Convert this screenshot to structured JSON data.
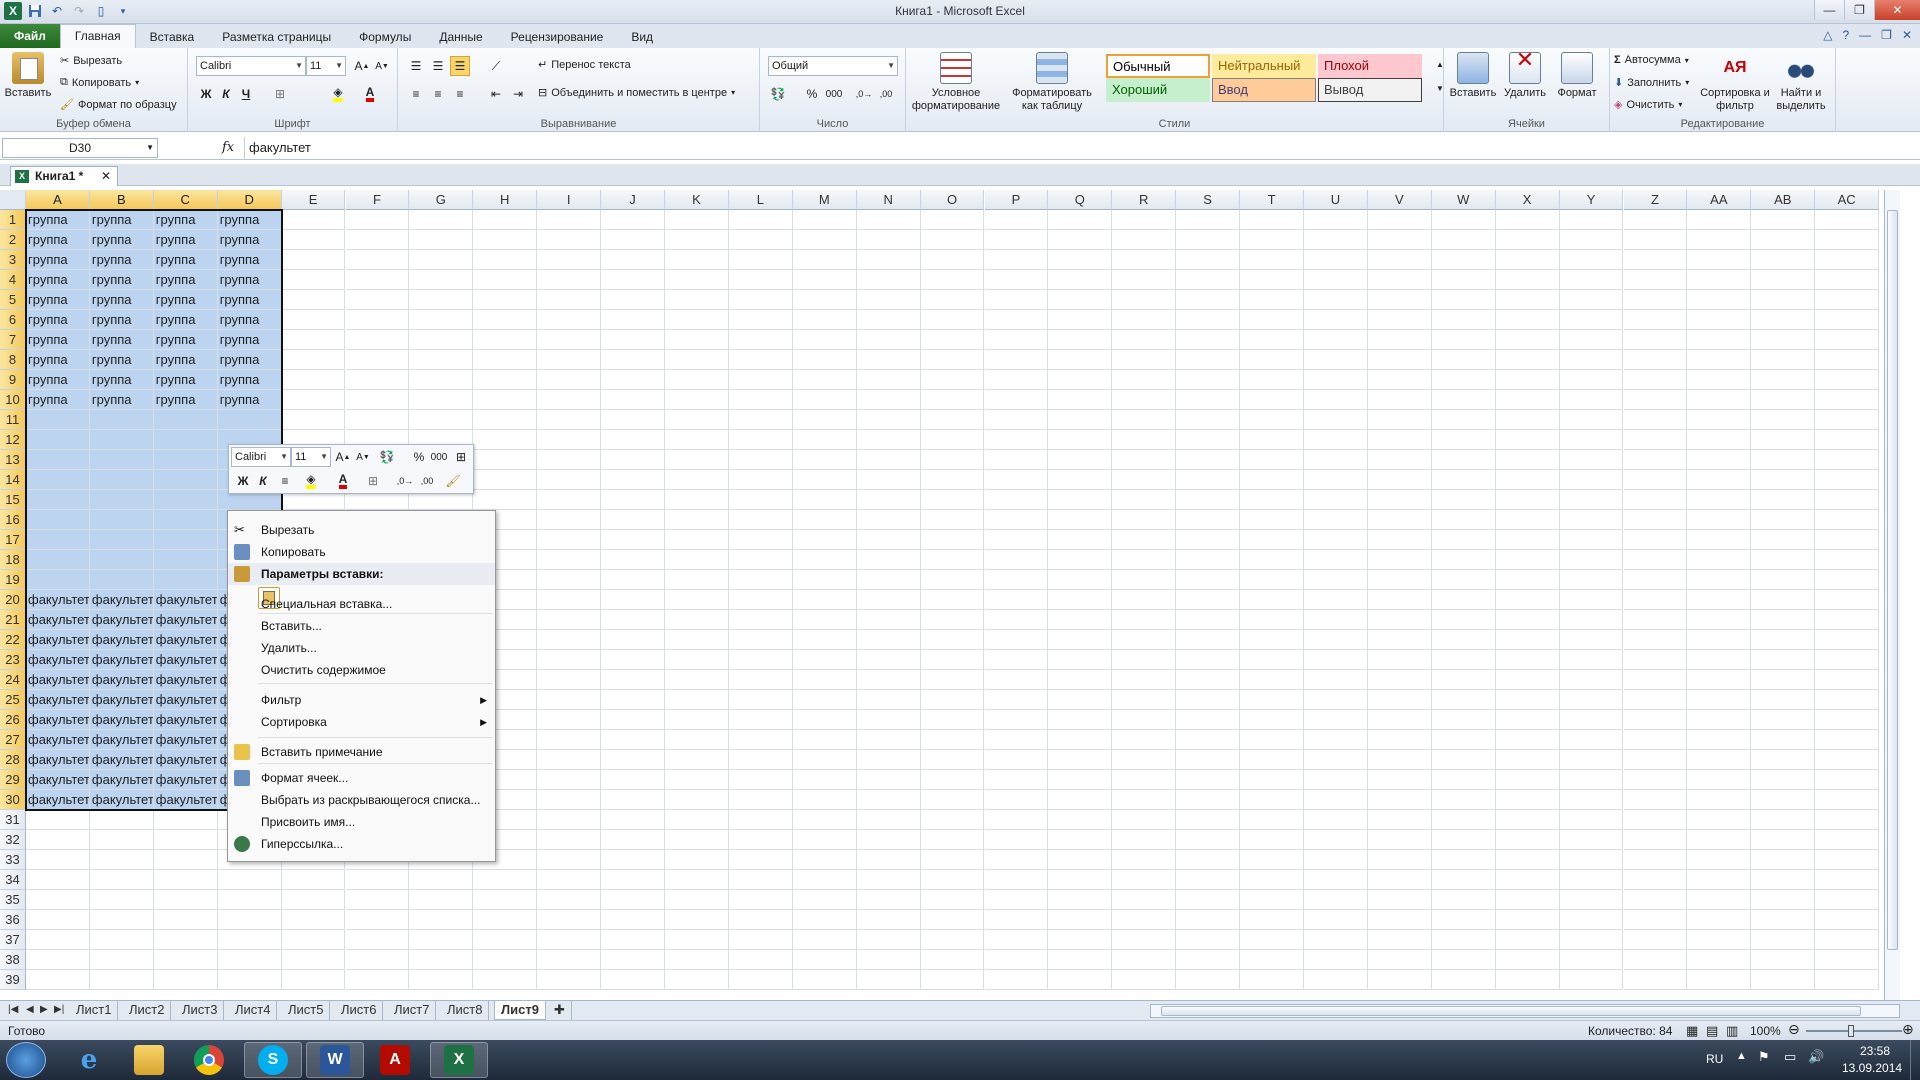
{
  "window": {
    "title": "Книга1 - Microsoft Excel"
  },
  "ribbon_tabs": [
    "Файл",
    "Главная",
    "Вставка",
    "Разметка страницы",
    "Формулы",
    "Данные",
    "Рецензирование",
    "Вид"
  ],
  "clipboard": {
    "paste": "Вставить",
    "cut": "Вырезать",
    "copy": "Копировать",
    "format_painter": "Формат по образцу",
    "label": "Буфер обмена"
  },
  "font": {
    "name": "Calibri",
    "size": "11",
    "bold": "Ж",
    "italic": "К",
    "underline": "Ч",
    "label": "Шрифт"
  },
  "alignment": {
    "wrap": "Перенос текста",
    "merge": "Объединить и поместить в центре",
    "label": "Выравнивание"
  },
  "number": {
    "format": "Общий",
    "percent": "%",
    "thousands": "000",
    "label": "Число"
  },
  "styles": {
    "cond_format": "Условное форматирование",
    "as_table": "Форматировать как таблицу",
    "cells": [
      {
        "name": "Обычный",
        "bg": "#ffffff",
        "fg": "#000000",
        "border": "#f0a030"
      },
      {
        "name": "Нейтральный",
        "bg": "#ffeb9c",
        "fg": "#9c6500",
        "border": "#ffeb9c"
      },
      {
        "name": "Плохой",
        "bg": "#ffc7ce",
        "fg": "#9c0006",
        "border": "#ffc7ce"
      },
      {
        "name": "Хороший",
        "bg": "#c6efce",
        "fg": "#006100",
        "border": "#c6efce"
      },
      {
        "name": "Ввод",
        "bg": "#ffcc99",
        "fg": "#3f3f76",
        "border": "#7f7f7f"
      },
      {
        "name": "Вывод",
        "bg": "#f2f2f2",
        "fg": "#3f3f3f",
        "border": "#3f3f3f"
      }
    ],
    "label": "Стили"
  },
  "cells_group": {
    "insert": "Вставить",
    "delete": "Удалить",
    "format": "Формат",
    "label": "Ячейки"
  },
  "editing": {
    "autosum": "Автосумма",
    "fill": "Заполнить",
    "clear": "Очистить",
    "sort": "Сортировка и фильтр",
    "find": "Найти и выделить",
    "label": "Редактирование"
  },
  "formula_bar": {
    "name_box": "D30",
    "fx": "fx",
    "value": "факультет"
  },
  "workbook_tab": {
    "name": "Книга1 *",
    "close": "✕"
  },
  "grid": {
    "columns": [
      "A",
      "B",
      "C",
      "D",
      "E",
      "F",
      "G",
      "H",
      "I",
      "J",
      "K",
      "L",
      "M",
      "N",
      "O",
      "P",
      "Q",
      "R",
      "S",
      "T",
      "U",
      "V",
      "W",
      "X",
      "Y",
      "Z",
      "AA",
      "AB",
      "AC"
    ],
    "row_count": 39,
    "group_text": "группа",
    "faculty_text": "факультет"
  },
  "mini_toolbar": {
    "font": "Calibri",
    "size": "11",
    "bold": "Ж",
    "italic": "К",
    "percent": "%",
    "thousands": "000"
  },
  "context_menu": {
    "items": [
      {
        "label": "Вырезать",
        "icon": "scissors-icon"
      },
      {
        "label": "Копировать",
        "icon": "copy-icon"
      },
      {
        "label": "Параметры вставки:",
        "icon": "paste-options-icon",
        "header": true
      },
      {
        "label": "Специальная вставка...",
        "icon": ""
      },
      {
        "label": "Вставить...",
        "icon": ""
      },
      {
        "label": "Удалить...",
        "icon": ""
      },
      {
        "label": "Очистить содержимое",
        "icon": ""
      },
      {
        "label": "Фильтр",
        "icon": "",
        "submenu": true
      },
      {
        "label": "Сортировка",
        "icon": "",
        "submenu": true
      },
      {
        "label": "Вставить примечание",
        "icon": "comment-icon"
      },
      {
        "label": "Формат ячеек...",
        "icon": "format-cells-icon"
      },
      {
        "label": "Выбрать из раскрывающегося списка...",
        "icon": ""
      },
      {
        "label": "Присвоить имя...",
        "icon": ""
      },
      {
        "label": "Гиперссылка...",
        "icon": "hyperlink-icon"
      }
    ]
  },
  "sheets": [
    "Лист1",
    "Лист2",
    "Лист3",
    "Лист4",
    "Лист5",
    "Лист6",
    "Лист7",
    "Лист8",
    "Лист9"
  ],
  "active_sheet": "Лист9",
  "status": {
    "ready": "Готово",
    "count": "Количество: 84",
    "zoom": "100%"
  },
  "taskbar": {
    "lang": "RU",
    "time": "23:58",
    "date": "13.09.2014"
  }
}
